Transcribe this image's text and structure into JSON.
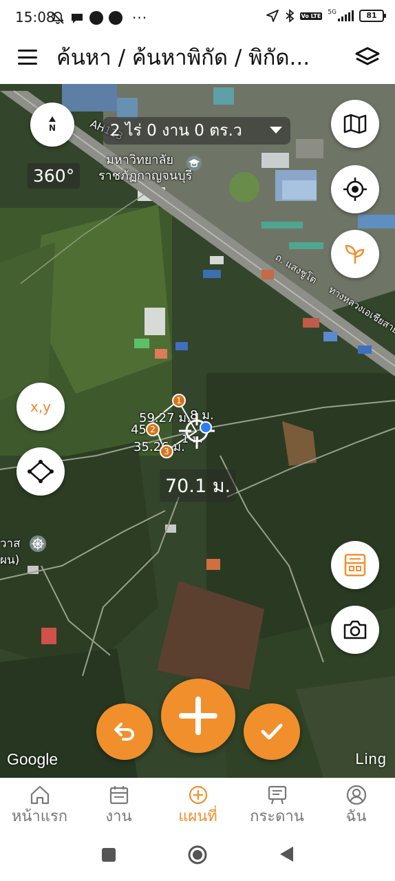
{
  "status_bar": {
    "time": "15:08",
    "more": "···",
    "volte": "Vo LTE",
    "network": "5G",
    "battery": "81"
  },
  "app_bar": {
    "title": "ค้นหา / ค้นหาพิกัด / พิกัด..."
  },
  "map": {
    "area_selector": "2 ไร่ 0 งาน 0 ตร.ว",
    "heading": "360°",
    "compass_letter": "N",
    "coordinate_button": "x,y",
    "distance_label": "70.1 ม.",
    "labels": {
      "road_ah": "AH123",
      "university_line1": "มหาวิทยาลัย",
      "university_line2": "ราชภัฏกาญจนบุรี",
      "road_saengchuto": "ถ. แสงชูโต",
      "road_asian": "ทางหลวงเอเชียสาย",
      "temple_1": "วาส",
      "temple_2": "ผน)"
    },
    "measurements": {
      "segment_a": "59.27 ม.",
      "segment_b": "8 ม.",
      "segment_c": "45.5",
      "segment_d": "35.26 ม.",
      "segment_e": "1 ม."
    },
    "vertex_markers": [
      "1",
      "2",
      "3"
    ],
    "attribution": "Google",
    "brand": "Ling"
  },
  "bottom_nav": {
    "items": [
      {
        "label": "หน้าแรก",
        "icon": "home-icon",
        "active": false
      },
      {
        "label": "งาน",
        "icon": "calendar-icon",
        "active": false
      },
      {
        "label": "แผนที่",
        "icon": "add-circle-icon",
        "active": true
      },
      {
        "label": "กระดาน",
        "icon": "board-icon",
        "active": false
      },
      {
        "label": "ฉัน",
        "icon": "profile-icon",
        "active": false
      }
    ]
  },
  "colors": {
    "accent": "#f18f2c",
    "inactive": "#777777",
    "location_dot": "#2f7cf6"
  }
}
